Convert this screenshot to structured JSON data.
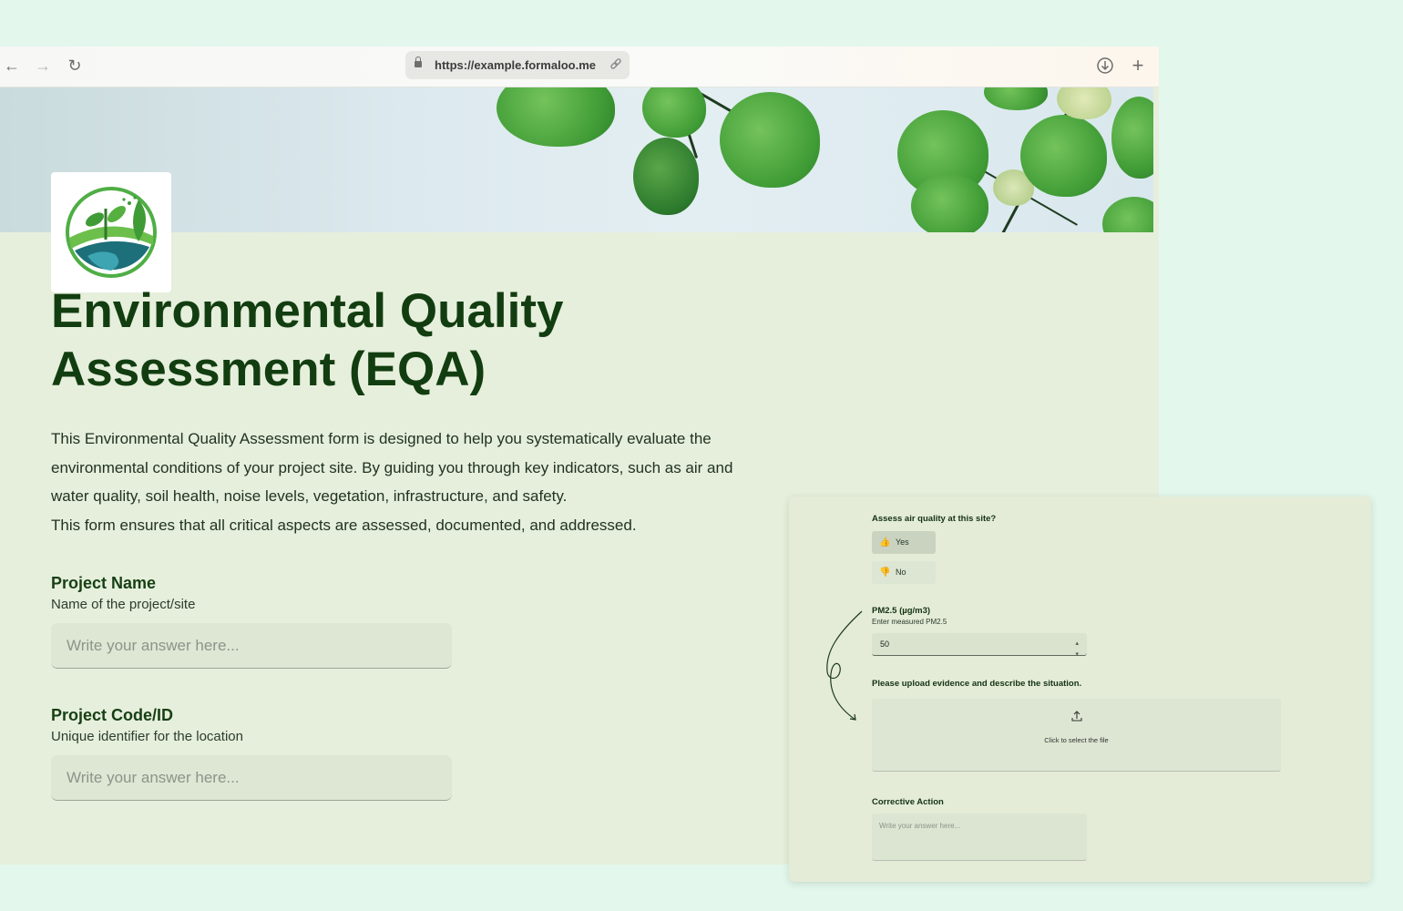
{
  "browser": {
    "url": "https://example.formaloo.me",
    "back_icon": "←",
    "forward_icon": "→",
    "reload_icon": "↻",
    "download_icon": "⊕",
    "new_tab_icon": "+",
    "link_icon": "🔗"
  },
  "form": {
    "title_line1": "Environmental Quality",
    "title_line2": "Assessment (EQA)",
    "description": [
      "This Environmental Quality Assessment form is designed to help you systematically evaluate the",
      "environmental conditions of your project site. By guiding you through key indicators, such as air and",
      "water quality, soil health, noise levels, vegetation, infrastructure, and safety.",
      "This form ensures that all critical aspects are assessed, documented, and addressed."
    ],
    "fields": [
      {
        "label": "Project Name",
        "help": "Name of the project/site",
        "placeholder": "Write your answer here..."
      },
      {
        "label": "Project Code/ID",
        "help": "Unique identifier for the location",
        "placeholder": "Write your answer here..."
      }
    ]
  },
  "panel": {
    "air_question": "Assess air quality at this site?",
    "yes_label": "Yes",
    "no_label": "No",
    "pm_label": "PM2.5 (µg/m3)",
    "pm_help": "Enter measured PM2.5",
    "pm_value": "50",
    "upload_label": "Please upload evidence and describe the situation.",
    "upload_text": "Click to select the file",
    "corrective_label": "Corrective Action",
    "corrective_placeholder": "Write your answer here..."
  },
  "colors": {
    "page_bg": "#e3f7ec",
    "form_bg": "#e6efdc",
    "title": "#123d10",
    "selected_choice": "#c9d3c0"
  }
}
